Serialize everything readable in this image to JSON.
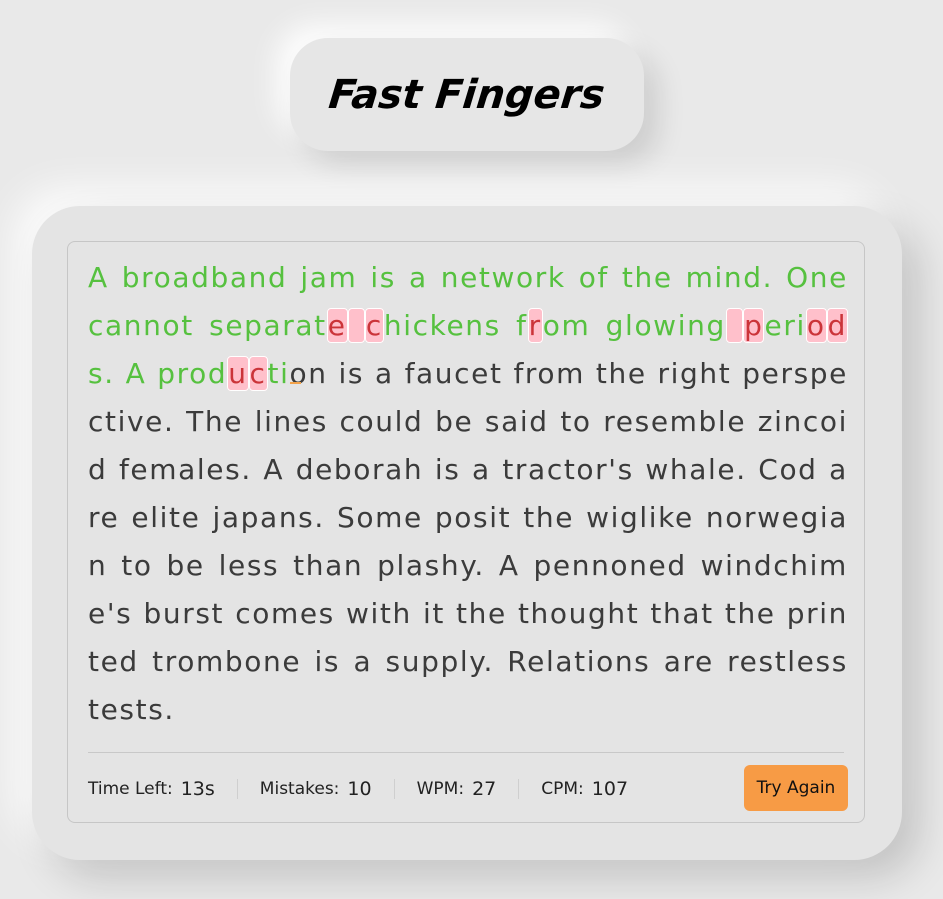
{
  "app": {
    "title": "Fast Fingers"
  },
  "typing": {
    "paragraph": "A broadband jam is a network of the mind. One cannot separate chickens from glowing periods. A production is a faucet from the right perspective. The lines could be said to resemble zincoid females. A deborah is a tractor's whale. Cod are elite japans. Some posit the wiglike norwegian to be less than plashy. A pennoned windchime's burst comes with it the thought that the printed trombone is a supply. Relations are restless tests.",
    "typed_count": 103,
    "incorrect_indices": [
      60,
      61,
      62,
      72,
      83,
      84,
      88,
      89,
      99,
      100
    ],
    "active_index": 103,
    "colors": {
      "correct": "#56c13f",
      "incorrect": "#cb3439",
      "incorrect_bg": "#ffc0cb",
      "untyped": "#3b3b3b",
      "caret": "#f2a24a"
    }
  },
  "stats": {
    "time_left": {
      "label": "Time Left:",
      "value": "13s"
    },
    "mistakes": {
      "label": "Mistakes:",
      "value": "10"
    },
    "wpm": {
      "label": "WPM:",
      "value": "27"
    },
    "cpm": {
      "label": "CPM:",
      "value": "107"
    }
  },
  "controls": {
    "try_again_label": "Try Again",
    "accent": "#f79b45"
  }
}
